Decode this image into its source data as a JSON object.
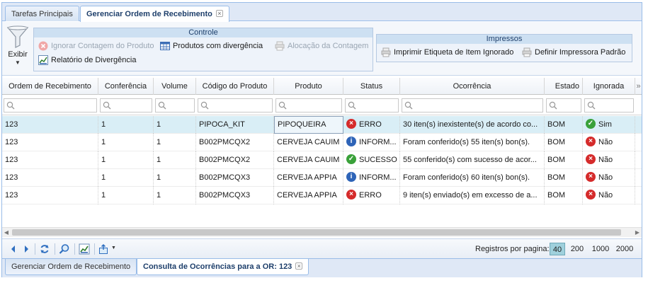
{
  "top_tabs": [
    {
      "label": "Tarefas Principais",
      "active": false
    },
    {
      "label": "Gerenciar Ordem de Recebimento",
      "active": true,
      "closable": true
    }
  ],
  "toolbar": {
    "filter_label": "Exibir",
    "controle": {
      "title": "Controle",
      "buttons": [
        {
          "label": "Ignorar Contagem do Produto",
          "enabled": false,
          "icon": "cancel-icon"
        },
        {
          "label": "Produtos com divergência",
          "enabled": true,
          "icon": "table-icon"
        },
        {
          "label": "Alocação da Contagem",
          "enabled": false,
          "icon": "printer-icon"
        },
        {
          "label": "Relatório de Divergência",
          "enabled": true,
          "icon": "chart-icon"
        }
      ]
    },
    "impressos": {
      "title": "Impressos",
      "buttons": [
        {
          "label": "Imprimir Etiqueta de Item Ignorado",
          "icon": "printer-icon"
        },
        {
          "label": "Definir Impressora Padrão",
          "icon": "printer-icon"
        }
      ]
    }
  },
  "grid": {
    "columns": [
      "Ordem de Recebimento",
      "Conferência",
      "Volume",
      "Código do Produto",
      "Produto",
      "Status",
      "Ocorrência",
      "Estado",
      "Ignorada"
    ],
    "rows": [
      {
        "ordem": "123",
        "conferencia": "1",
        "volume": "1",
        "codigo": "PIPOCA_KIT",
        "produto": "PIPOQUEIRA",
        "status": "ERRO",
        "status_type": "error",
        "ocorrencia": "30 iten(s) inexistente(s) de acordo co...",
        "estado": "BOM",
        "ignorada": "Sim",
        "ignorada_type": "ok",
        "selected": true
      },
      {
        "ordem": "123",
        "conferencia": "1",
        "volume": "1",
        "codigo": "B002PMCQX2",
        "produto": "CERVEJA CAUIM",
        "status": "INFORM...",
        "status_type": "info",
        "ocorrencia": "Foram conferido(s) 55 iten(s) bon(s).",
        "estado": "BOM",
        "ignorada": "Não",
        "ignorada_type": "error",
        "selected": false
      },
      {
        "ordem": "123",
        "conferencia": "1",
        "volume": "1",
        "codigo": "B002PMCQX2",
        "produto": "CERVEJA CAUIM",
        "status": "SUCESSO",
        "status_type": "ok",
        "ocorrencia": "55 conferido(s) com sucesso de acor...",
        "estado": "BOM",
        "ignorada": "Não",
        "ignorada_type": "error",
        "selected": false
      },
      {
        "ordem": "123",
        "conferencia": "1",
        "volume": "1",
        "codigo": "B002PMCQX3",
        "produto": "CERVEJA APPIA",
        "status": "INFORM...",
        "status_type": "info",
        "ocorrencia": "Foram conferido(s) 60 iten(s) bon(s).",
        "estado": "BOM",
        "ignorada": "Não",
        "ignorada_type": "error",
        "selected": false
      },
      {
        "ordem": "123",
        "conferencia": "1",
        "volume": "1",
        "codigo": "B002PMCQX3",
        "produto": "CERVEJA APPIA",
        "status": "ERRO",
        "status_type": "error",
        "ocorrencia": "9 iten(s) enviado(s) em excesso de a...",
        "estado": "BOM",
        "ignorada": "Não",
        "ignorada_type": "error",
        "selected": false
      }
    ]
  },
  "pager": {
    "label": "Registros por pagina:",
    "sizes": [
      "40",
      "200",
      "1000",
      "2000"
    ],
    "selected": "40"
  },
  "bottom_tabs": [
    {
      "label": "Gerenciar Ordem de Recebimento",
      "active": false
    },
    {
      "label": "Consulta de Ocorrências para a OR: 123",
      "active": true,
      "closable": true
    }
  ],
  "colors": {
    "accent": "#99bce8",
    "selected_row": "#d9eef6",
    "error": "#d52b2b",
    "info": "#2e64b8",
    "success": "#3aa13a"
  }
}
